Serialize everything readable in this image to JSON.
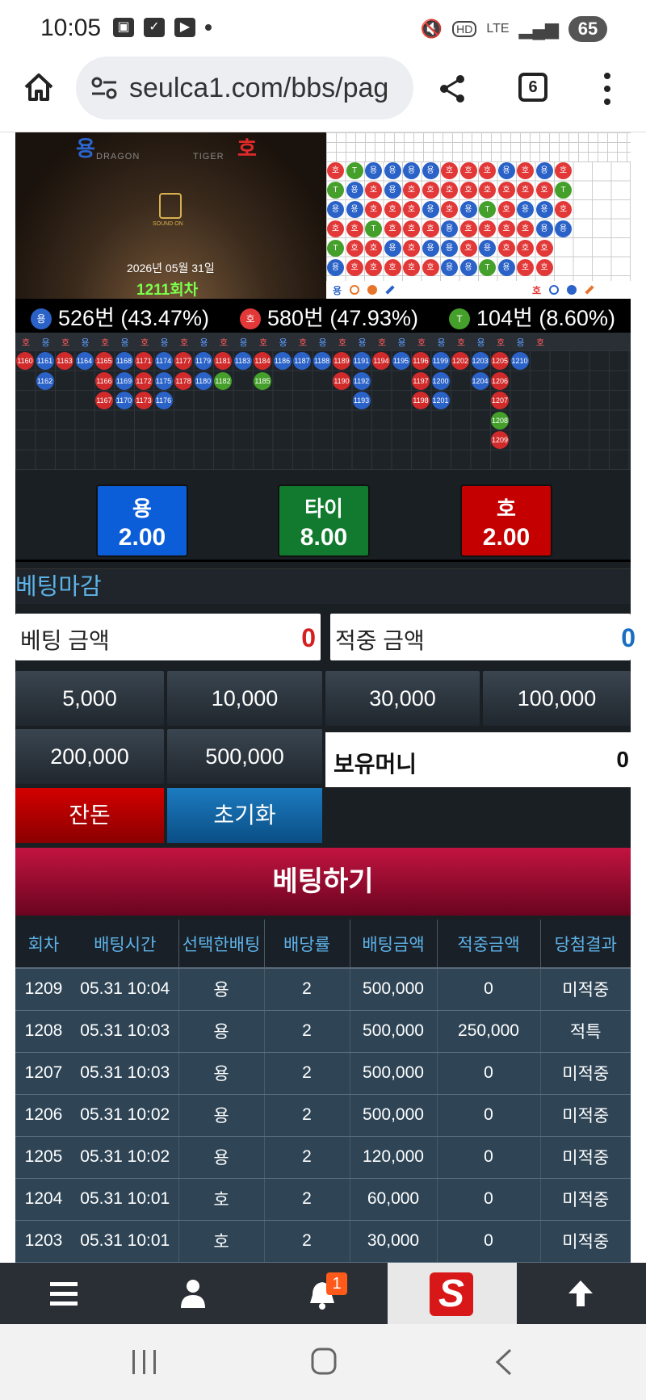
{
  "status_bar": {
    "time": "10:05",
    "network": "LTE",
    "battery": "65"
  },
  "browser": {
    "url": "seulca1.com/bbs/pag",
    "tab_count": "6"
  },
  "video": {
    "dragon_label": "DRAGON",
    "tiger_label": "TIGER",
    "dragon_mark": "용",
    "tiger_mark": "호",
    "sound_label": "SOUND ON",
    "date": "2026년 05월 31일",
    "round": "1211회차"
  },
  "scoreboard": {
    "bead_rows": [
      [
        "호",
        "T",
        "용",
        "용",
        "용",
        "용",
        "호",
        "호",
        "호",
        "용",
        "호",
        "용",
        "호"
      ],
      [
        "T",
        "용",
        "호",
        "용",
        "호",
        "호",
        "호",
        "호",
        "호",
        "호",
        "호",
        "호",
        "T"
      ],
      [
        "용",
        "용",
        "호",
        "호",
        "호",
        "용",
        "호",
        "용",
        "T",
        "호",
        "용",
        "용",
        "호"
      ],
      [
        "호",
        "호",
        "T",
        "호",
        "호",
        "호",
        "용",
        "호",
        "호",
        "호",
        "호",
        "용",
        "용"
      ],
      [
        "T",
        "호",
        "호",
        "용",
        "호",
        "용",
        "용",
        "호",
        "용",
        "호",
        "호",
        "호",
        ""
      ],
      [
        "용",
        "호",
        "호",
        "호",
        "호",
        "호",
        "용",
        "용",
        "T",
        "용",
        "호",
        "호",
        ""
      ]
    ],
    "legend_left": "용",
    "legend_right": "호"
  },
  "stats": {
    "dragon": {
      "icon": "용",
      "text": "526번 (43.47%)"
    },
    "tiger": {
      "icon": "호",
      "text": "580번 (47.93%)"
    },
    "tie": {
      "icon": "T",
      "text": "104번 (8.60%)"
    }
  },
  "road": {
    "header": [
      "호",
      "용",
      "호",
      "용",
      "호",
      "용",
      "호",
      "용",
      "호",
      "용",
      "호",
      "용",
      "호",
      "용",
      "호",
      "용",
      "호",
      "용",
      "호",
      "용",
      "호",
      "용",
      "호",
      "용",
      "호",
      "용",
      "호"
    ],
    "columns": [
      {
        "c": "t",
        "v": [
          "1160"
        ]
      },
      {
        "c": "d",
        "v": [
          "1161",
          "1162"
        ]
      },
      {
        "c": "t",
        "v": [
          "1163"
        ]
      },
      {
        "c": "d",
        "v": [
          "1164"
        ]
      },
      {
        "c": "t",
        "v": [
          "1165",
          "1166",
          "1167"
        ]
      },
      {
        "c": "d",
        "v": [
          "1168",
          "1169",
          "1170"
        ]
      },
      {
        "c": "t",
        "v": [
          "1171",
          "1172",
          "1173"
        ]
      },
      {
        "c": "d",
        "v": [
          "1174",
          "1175",
          "1176"
        ]
      },
      {
        "c": "t",
        "v": [
          "1177",
          "1178"
        ]
      },
      {
        "c": "d",
        "v": [
          "1179",
          "1180"
        ]
      },
      {
        "c": "t",
        "v": [
          "1181",
          "1182"
        ]
      },
      {
        "c": "d",
        "v": [
          "1183"
        ]
      },
      {
        "c": "t",
        "v": [
          "1184",
          "1185"
        ]
      },
      {
        "c": "d",
        "v": [
          "1186"
        ]
      },
      {
        "c": "d",
        "v": [
          "1187"
        ]
      },
      {
        "c": "d",
        "v": [
          "1188"
        ]
      },
      {
        "c": "t",
        "v": [
          "1189",
          "1190"
        ]
      },
      {
        "c": "d",
        "v": [
          "1191",
          "1192",
          "1193"
        ]
      },
      {
        "c": "t",
        "v": [
          "1194"
        ]
      },
      {
        "c": "d",
        "v": [
          "1195"
        ]
      },
      {
        "c": "t",
        "v": [
          "1196",
          "1197",
          "1198"
        ]
      },
      {
        "c": "d",
        "v": [
          "1199",
          "1200",
          "1201"
        ]
      },
      {
        "c": "t",
        "v": [
          "1202"
        ]
      },
      {
        "c": "d",
        "v": [
          "1203",
          "1204"
        ]
      },
      {
        "c": "t",
        "v": [
          "1205",
          "1206",
          "1207",
          "1208",
          "1209"
        ]
      },
      {
        "c": "d",
        "v": [
          "1210"
        ]
      }
    ]
  },
  "odds": {
    "dragon": {
      "name": "용",
      "value": "2.00",
      "color": "#0b5ed7"
    },
    "tie": {
      "name": "타이",
      "value": "8.00",
      "color": "#117a2e"
    },
    "tiger": {
      "name": "호",
      "value": "2.00",
      "color": "#c40000"
    }
  },
  "betting_closed": "베팅마감",
  "bet_amount": {
    "label": "베팅 금액",
    "value": "0"
  },
  "win_amount": {
    "label": "적중 금액",
    "value": "0"
  },
  "chips": [
    "5,000",
    "10,000",
    "30,000",
    "100,000",
    "200,000",
    "500,000"
  ],
  "holding": {
    "label": "보유머니",
    "value": "0"
  },
  "buttons": {
    "balance": "잔돈",
    "reset": "초기화",
    "bet": "베팅하기"
  },
  "history": {
    "headers": [
      "회차",
      "배팅시간",
      "선택한배팅",
      "배당률",
      "배팅금액",
      "적중금액",
      "당첨결과"
    ],
    "rows": [
      [
        "1209",
        "05.31 10:04",
        "용",
        "2",
        "500,000",
        "0",
        "미적중"
      ],
      [
        "1208",
        "05.31 10:03",
        "용",
        "2",
        "500,000",
        "250,000",
        "적특"
      ],
      [
        "1207",
        "05.31 10:03",
        "용",
        "2",
        "500,000",
        "0",
        "미적중"
      ],
      [
        "1206",
        "05.31 10:02",
        "용",
        "2",
        "500,000",
        "0",
        "미적중"
      ],
      [
        "1205",
        "05.31 10:02",
        "용",
        "2",
        "120,000",
        "0",
        "미적중"
      ],
      [
        "1204",
        "05.31 10:01",
        "호",
        "2",
        "60,000",
        "0",
        "미적중"
      ],
      [
        "1203",
        "05.31 10:01",
        "호",
        "2",
        "30,000",
        "0",
        "미적중"
      ]
    ]
  },
  "bottom_nav": {
    "notification_count": "1",
    "logo": "S"
  }
}
